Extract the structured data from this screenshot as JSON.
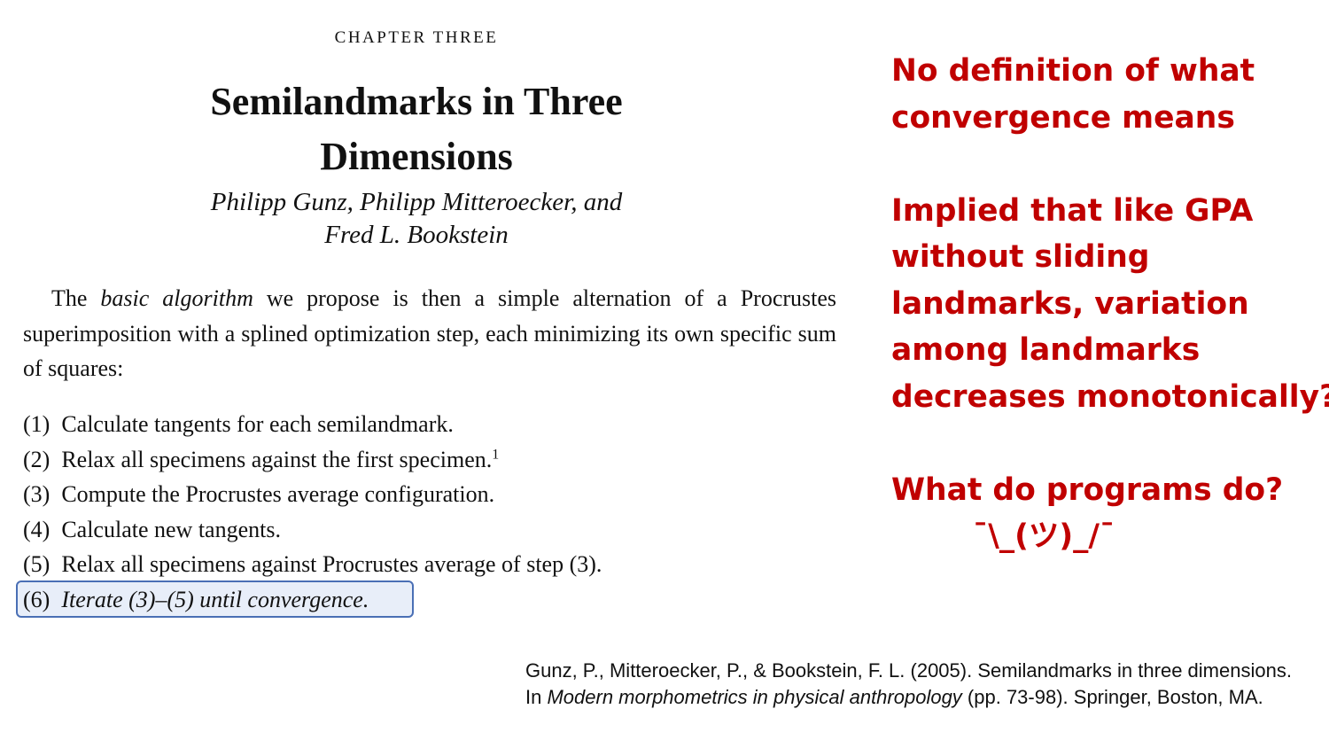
{
  "book": {
    "chapter_label": "CHAPTER THREE",
    "title_line1": "Semilandmarks in Three",
    "title_line2": "Dimensions",
    "authors_line1": "Philipp Gunz, Philipp Mitteroecker, and",
    "authors_line2": "Fred L. Bookstein"
  },
  "intro": {
    "text_before": "The ",
    "emphasis": "basic algorithm",
    "text_after": " we propose is then a simple alternation of a Procrustes superimposition with a splined optimization step, each minimizing its own specific sum of squares:"
  },
  "steps": [
    {
      "num": "(1)",
      "text": "Calculate tangents for each semilandmark."
    },
    {
      "num": "(2)",
      "text": "Relax all specimens against the first specimen.",
      "footnote": "1"
    },
    {
      "num": "(3)",
      "text": "Compute the Procrustes average configuration."
    },
    {
      "num": "(4)",
      "text": "Calculate new tangents."
    },
    {
      "num": "(5)",
      "text": "Relax all specimens against Procrustes average of step (3)."
    },
    {
      "num": "(6)",
      "text": "Iterate (3)–(5) until convergence."
    }
  ],
  "annotations": {
    "color": "#c00000",
    "note1_line1": "No definition of what",
    "note1_line2": "convergence means",
    "note2_line1": "Implied that like GPA",
    "note2_line2": "without sliding",
    "note2_line3": "landmarks, variation",
    "note2_line4": "among landmarks",
    "note2_line5": "decreases monotonically?",
    "note3_line1": "What do programs do?",
    "shrug": "¯\\_(ツ)_/¯"
  },
  "citation": {
    "part1": "Gunz, P., Mitteroecker, P., & Bookstein, F. L. (2005). Semilandmarks in three dimensions. In ",
    "book_title": "Modern morphometrics in physical anthropology",
    "part2": " (pp. 73-98). Springer, Boston, MA."
  },
  "highlight_color": "#4a6fb5"
}
